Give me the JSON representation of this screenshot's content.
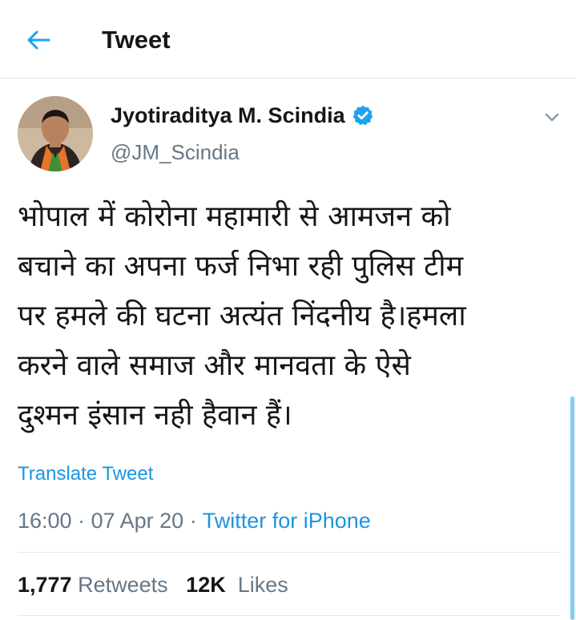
{
  "header": {
    "title": "Tweet",
    "back_icon": "back-arrow-icon"
  },
  "author": {
    "name": "Jyotiraditya M. Scindia",
    "handle": "@JM_Scindia",
    "verified": true,
    "verified_icon": "verified-badge-icon"
  },
  "tweet": {
    "lines": [
      "भोपाल में कोरोना महामारी से आमजन को",
      "बचाने का अपना फर्ज निभा रही पुलिस टीम",
      "पर हमले की घटना अत्यंत निंदनीय है।हमला",
      "करने वाले समाज और मानवता के ऐसे",
      "दुश्मन इंसान नही हैवान हैं।"
    ],
    "translate_label": "Translate Tweet",
    "time": "16:00",
    "date": "07 Apr 20",
    "separator": "·",
    "source": "Twitter for iPhone"
  },
  "stats": {
    "retweets_count": "1,777",
    "retweets_label": "Retweets",
    "likes_count": "12K",
    "likes_label": "Likes"
  },
  "colors": {
    "accent": "#1da1f2",
    "link": "#1b95e0",
    "secondary_text": "#657786",
    "divider": "#e1e8ed"
  }
}
